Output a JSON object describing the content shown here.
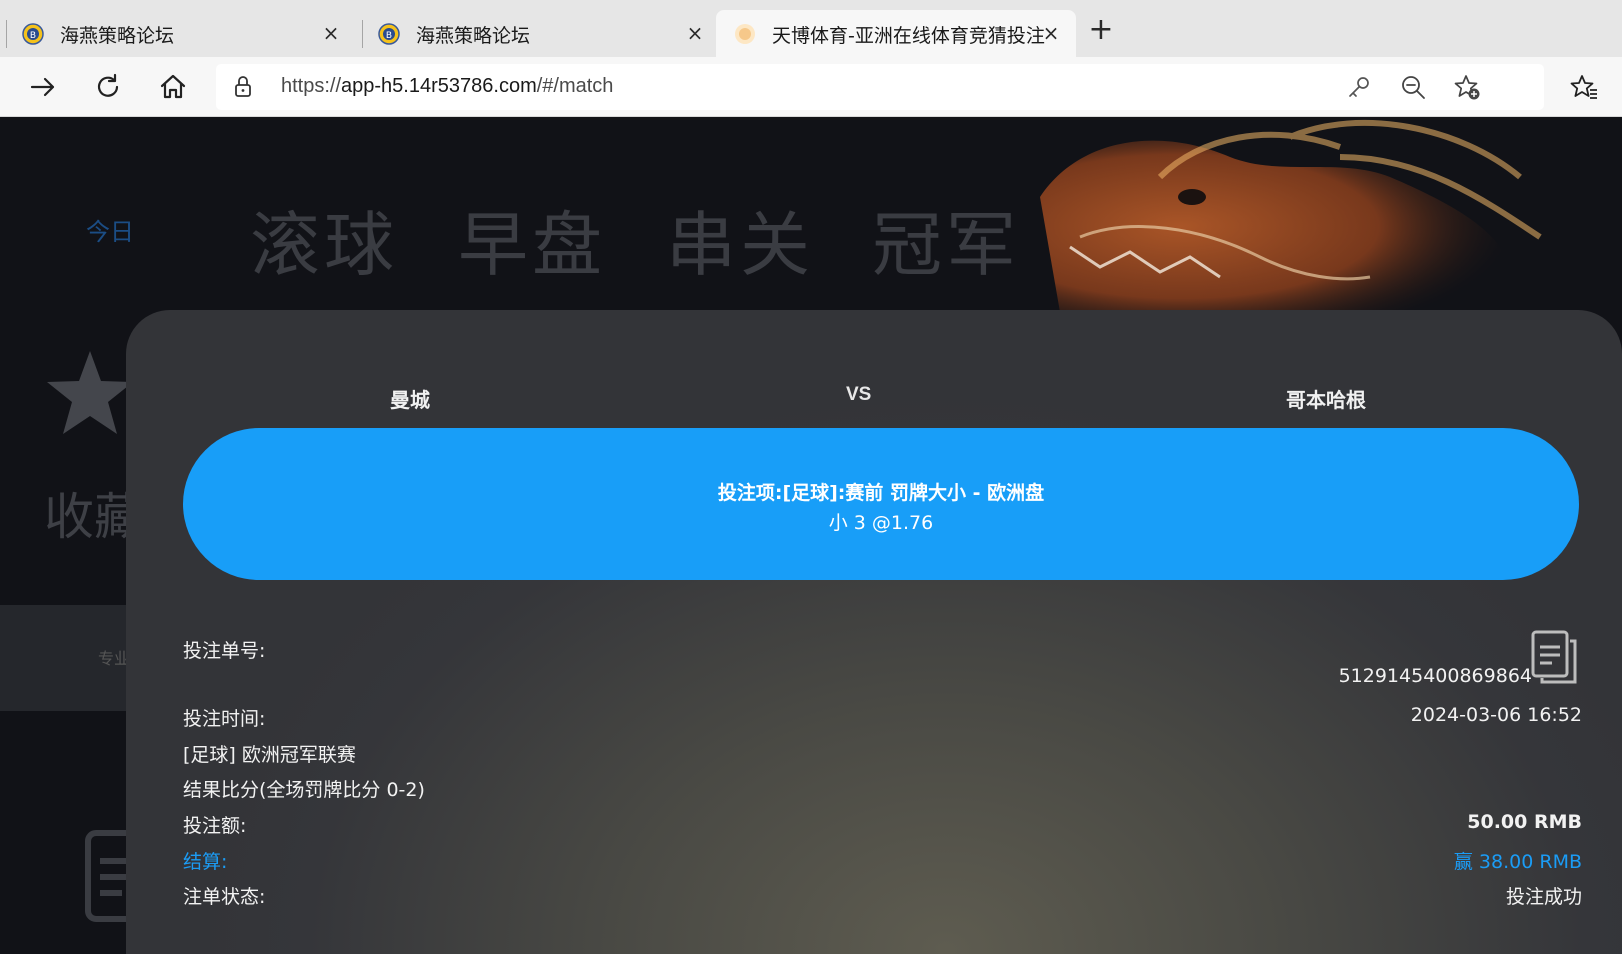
{
  "browser": {
    "tabs": [
      {
        "title": "海燕策略论坛",
        "active": false
      },
      {
        "title": "海燕策略论坛",
        "active": false
      },
      {
        "title": "天博体育-亚洲在线体育竞猜投注",
        "active": true
      }
    ],
    "close_glyph": "×",
    "new_tab_glyph": "+",
    "url_prefix": "https://",
    "url_host": "app-h5.14r53786.com",
    "url_path": "/#/match"
  },
  "page": {
    "nav": {
      "today": "今日",
      "tabs": [
        "滚球",
        "早盘",
        "串关",
        "冠军"
      ]
    },
    "favorites_label": "收藏",
    "pill_text": "专业"
  },
  "bet": {
    "home_team": "曼城",
    "vs": "VS",
    "away_team": "哥本哈根",
    "selection_title": "投注项:[足球]:赛前 罚牌大小 - 欧洲盘",
    "selection_odds": "小 3 @1.76",
    "order_no_label": "投注单号:",
    "order_no": "5129145400869864",
    "time_label": "投注时间:",
    "time": "2024-03-06 16:52",
    "league": "[足球] 欧洲冠军联赛",
    "result": "结果比分(全场罚牌比分 0-2)",
    "amount_label": "投注额:",
    "amount": "50.00 RMB",
    "settle_label": "结算:",
    "settle": "赢 38.00 RMB",
    "status_label": "注单状态:",
    "status": "投注成功"
  },
  "colors": {
    "accent_blue": "#189ef8",
    "settle_blue": "#1b9cf5"
  }
}
